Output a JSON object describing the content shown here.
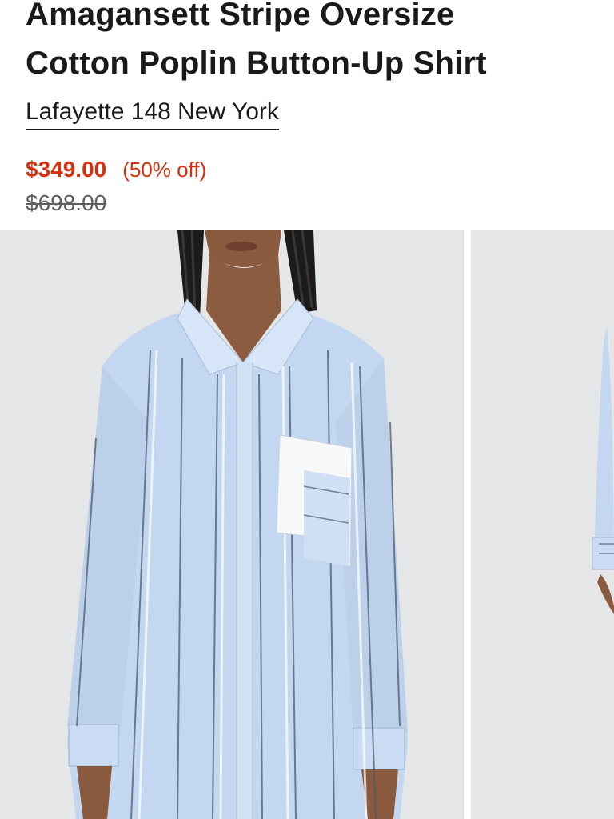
{
  "product": {
    "title_line1": "Amagansett Stripe Oversize",
    "title_line2": "Cotton Poplin Button-Up Shirt",
    "brand": "Lafayette 148 New York",
    "sale_price": "$349.00",
    "discount": "(50% off)",
    "original_price": "$698.00"
  },
  "gallery": {
    "images": [
      {
        "icon": "product-photo-front"
      },
      {
        "icon": "product-photo-side"
      }
    ]
  },
  "colors": {
    "sale": "#d5310f",
    "text": "#191a1b",
    "photo_background": "#e5e6e8",
    "shirt": "#c3d7f0"
  }
}
